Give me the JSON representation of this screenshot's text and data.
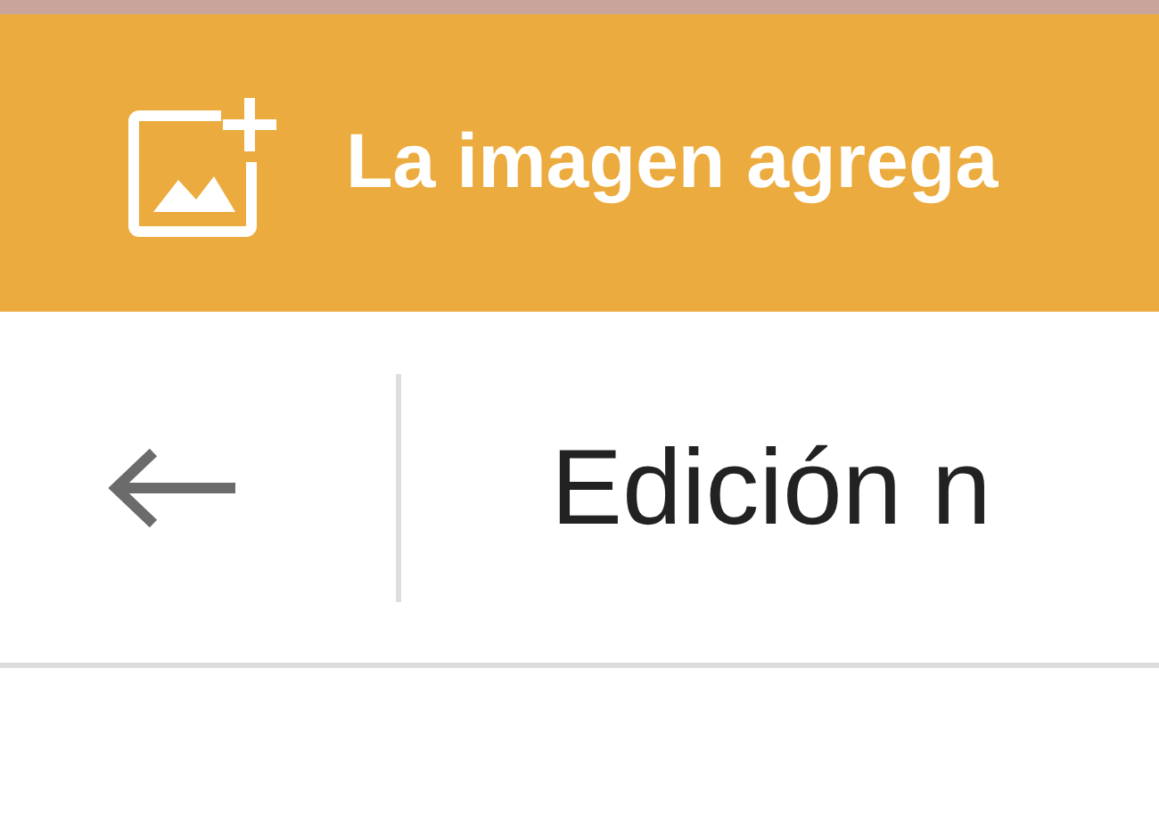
{
  "banner": {
    "message": "La imagen agrega"
  },
  "header": {
    "title": "Edición n"
  }
}
